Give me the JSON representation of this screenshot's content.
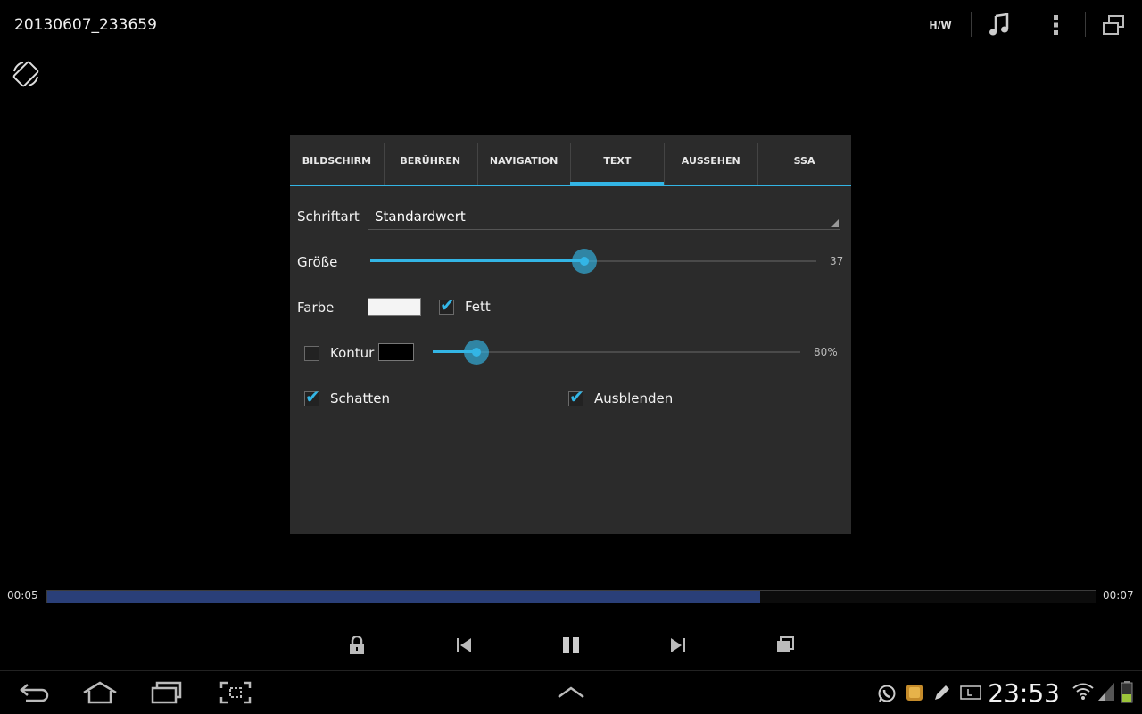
{
  "app": {
    "title": "20130607_233659",
    "hw_label": "H/W"
  },
  "dialog": {
    "tabs": [
      {
        "label": "BILDSCHIRM",
        "active": false
      },
      {
        "label": "BERÜHREN",
        "active": false
      },
      {
        "label": "NAVIGATION",
        "active": false
      },
      {
        "label": "TEXT",
        "active": true
      },
      {
        "label": "AUSSEHEN",
        "active": false
      },
      {
        "label": "SSA",
        "active": false
      }
    ],
    "font": {
      "label": "Schriftart",
      "value": "Standardwert"
    },
    "size": {
      "label": "Größe",
      "value": "37",
      "fraction": 0.48
    },
    "color": {
      "label": "Farbe",
      "swatch": "#f4f4f4"
    },
    "bold": {
      "label": "Fett",
      "checked": true
    },
    "outline": {
      "label": "Kontur",
      "checked": false,
      "swatch": "#000000",
      "value": "80%",
      "fraction": 0.12
    },
    "shadow": {
      "label": "Schatten",
      "checked": true
    },
    "fade": {
      "label": "Ausblenden",
      "checked": true
    }
  },
  "player": {
    "elapsed": "00:05",
    "total": "00:07",
    "progress": 0.68
  },
  "status": {
    "clock": "23:53"
  },
  "colors": {
    "accent": "#33b5e5",
    "progress_fill": "#2a3f78"
  }
}
